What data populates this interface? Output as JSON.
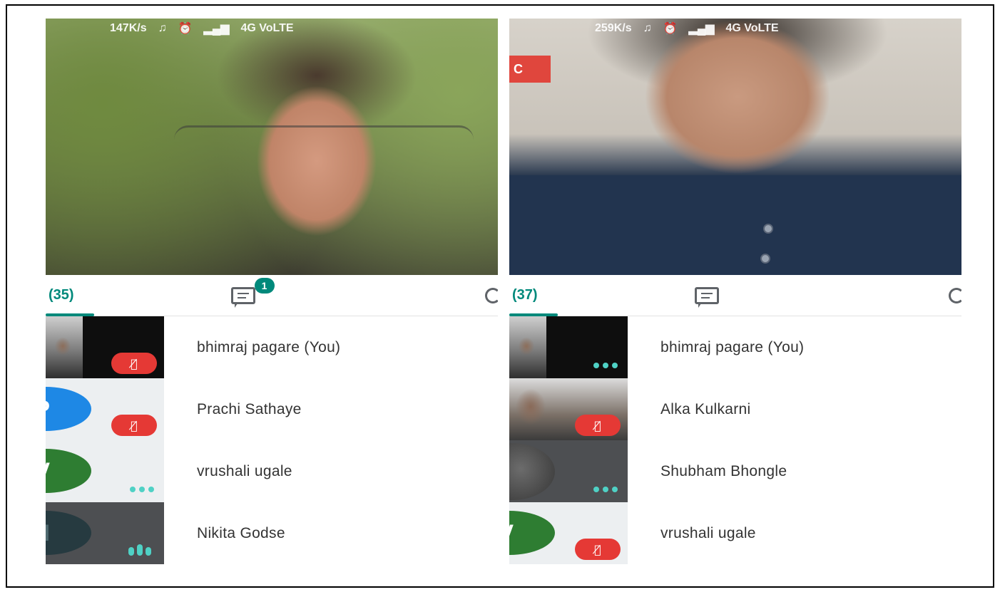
{
  "left_panel": {
    "statusbar": {
      "speed": "147K/s",
      "network": "4G VoLTE"
    },
    "participant_count": "(35)",
    "chat_badge": "1",
    "participants": [
      {
        "name": "bhimraj pagare (You)",
        "status": "muted"
      },
      {
        "name": "Prachi Sathaye",
        "initial": "P",
        "status": "muted"
      },
      {
        "name": "vrushali ugale",
        "initial": "V",
        "status": "more"
      },
      {
        "name": "Nikita Godse",
        "initial": "N",
        "status": "speaking"
      }
    ]
  },
  "right_panel": {
    "statusbar": {
      "speed": "259K/s",
      "network": "4G VoLTE"
    },
    "rec_label": "C",
    "participant_count": "(37)",
    "participants": [
      {
        "name": "bhimraj pagare (You)",
        "status": "more"
      },
      {
        "name": "Alka Kulkarni",
        "status": "muted"
      },
      {
        "name": "Shubham Bhongle",
        "status": "more"
      },
      {
        "name": "vrushali ugale",
        "initial": "V",
        "status": "muted"
      }
    ]
  },
  "colors": {
    "accent": "#00897b",
    "mic_off": "#e53935",
    "avatar_blue": "#1e88e5",
    "avatar_green": "#2e7d32"
  }
}
